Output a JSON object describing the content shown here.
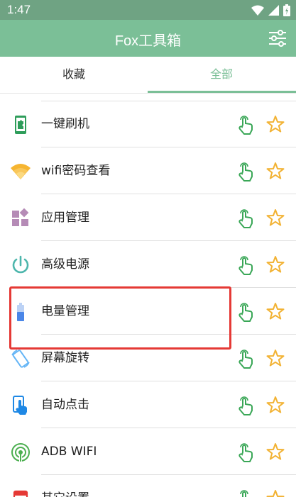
{
  "status_bar": {
    "time": "1:47"
  },
  "app_bar": {
    "title": "Fox工具箱"
  },
  "tabs": [
    {
      "label": "收藏"
    },
    {
      "label": "全部"
    }
  ],
  "colors": {
    "primary": "#7bbf97",
    "status": "#6fa383",
    "star": "#f2b233",
    "touch": "#3aa757",
    "highlight": "#e53935"
  },
  "items": [
    {
      "label": "一键刷机",
      "icon": "phone-puzzle-icon"
    },
    {
      "label": "wifi密码查看",
      "icon": "wifi-icon"
    },
    {
      "label": "应用管理",
      "icon": "apps-grid-icon"
    },
    {
      "label": "高级电源",
      "icon": "power-icon"
    },
    {
      "label": "电量管理",
      "icon": "battery-icon"
    },
    {
      "label": "屏幕旋转",
      "icon": "screen-rotate-icon"
    },
    {
      "label": "自动点击",
      "icon": "tap-hand-icon"
    },
    {
      "label": "ADB WIFI",
      "icon": "adb-wifi-icon"
    },
    {
      "label": "其它设置",
      "icon": "settings-red-icon"
    }
  ]
}
